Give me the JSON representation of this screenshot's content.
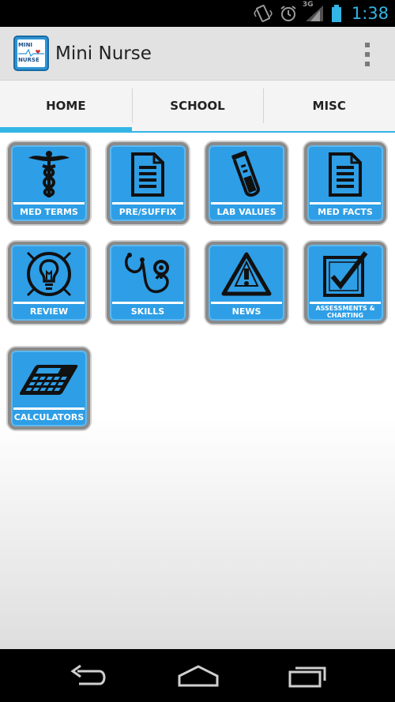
{
  "status_bar": {
    "network_label": "3G",
    "time": "1:38",
    "icons": [
      "vibrate-icon",
      "alarm-icon",
      "signal-icon",
      "battery-icon"
    ],
    "accent_color": "#33b5e5"
  },
  "action_bar": {
    "title": "Mini Nurse",
    "logo": {
      "line1": "MINI",
      "line2": "NURSE"
    },
    "overflow_icon": "overflow-menu-icon"
  },
  "tabs": [
    {
      "label": "HOME",
      "active": true
    },
    {
      "label": "SCHOOL",
      "active": false
    },
    {
      "label": "MISC",
      "active": false
    }
  ],
  "tiles": [
    {
      "label": "MED TERMS",
      "icon": "caduceus-icon"
    },
    {
      "label": "PRE/SUFFIX",
      "icon": "document-icon"
    },
    {
      "label": "LAB VALUES",
      "icon": "test-tube-icon"
    },
    {
      "label": "MED FACTS",
      "icon": "document-icon"
    },
    {
      "label": "REVIEW",
      "icon": "lightbulb-icon"
    },
    {
      "label": "SKILLS",
      "icon": "stethoscope-icon"
    },
    {
      "label": "NEWS",
      "icon": "warning-icon"
    },
    {
      "label": "ASSESSMENTS & CHARTING",
      "icon": "checkbox-icon"
    },
    {
      "label": "CALCULATORS",
      "icon": "calculator-icon"
    }
  ],
  "nav_bar": {
    "buttons": [
      "back-icon",
      "home-icon",
      "recent-apps-icon"
    ]
  },
  "colors": {
    "tile_blue": "#2e9ee6",
    "tab_indicator": "#33b5e5",
    "action_bar_bg": "#e2e2e2"
  }
}
